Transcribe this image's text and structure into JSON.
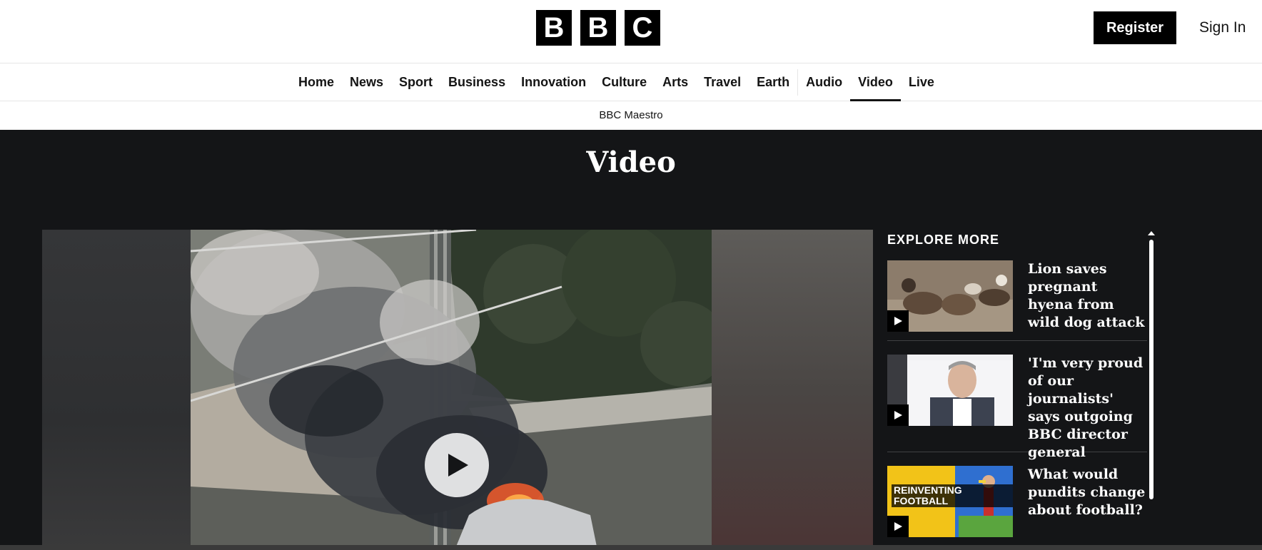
{
  "header": {
    "logo_letters": [
      "B",
      "B",
      "C"
    ],
    "register_label": "Register",
    "signin_label": "Sign In"
  },
  "nav": {
    "items": [
      {
        "label": "Home",
        "active": false
      },
      {
        "label": "News",
        "active": false
      },
      {
        "label": "Sport",
        "active": false
      },
      {
        "label": "Business",
        "active": false
      },
      {
        "label": "Innovation",
        "active": false
      },
      {
        "label": "Culture",
        "active": false
      },
      {
        "label": "Arts",
        "active": false
      },
      {
        "label": "Travel",
        "active": false
      },
      {
        "label": "Earth",
        "active": false
      },
      {
        "label": "Audio",
        "active": false
      },
      {
        "label": "Video",
        "active": true
      },
      {
        "label": "Live",
        "active": false
      }
    ],
    "subnav_link": "BBC Maestro"
  },
  "page": {
    "title": "Video"
  },
  "player": {
    "play_icon": "play-icon"
  },
  "explore": {
    "heading": "EXPLORE MORE",
    "items": [
      {
        "title": "Lion saves pregnant hyena from wild dog attack",
        "thumb_icon": "play-icon"
      },
      {
        "title": "'I'm very proud of our journalists' says outgoing BBC director general",
        "thumb_icon": "play-icon"
      },
      {
        "title": "What would pundits change about football?",
        "thumb_icon": "play-icon",
        "thumb_caption": "REINVENTING FOOTBALL"
      }
    ]
  },
  "colors": {
    "dark_bg": "#141517",
    "accent_black": "#000000",
    "text_white": "#ffffff"
  }
}
